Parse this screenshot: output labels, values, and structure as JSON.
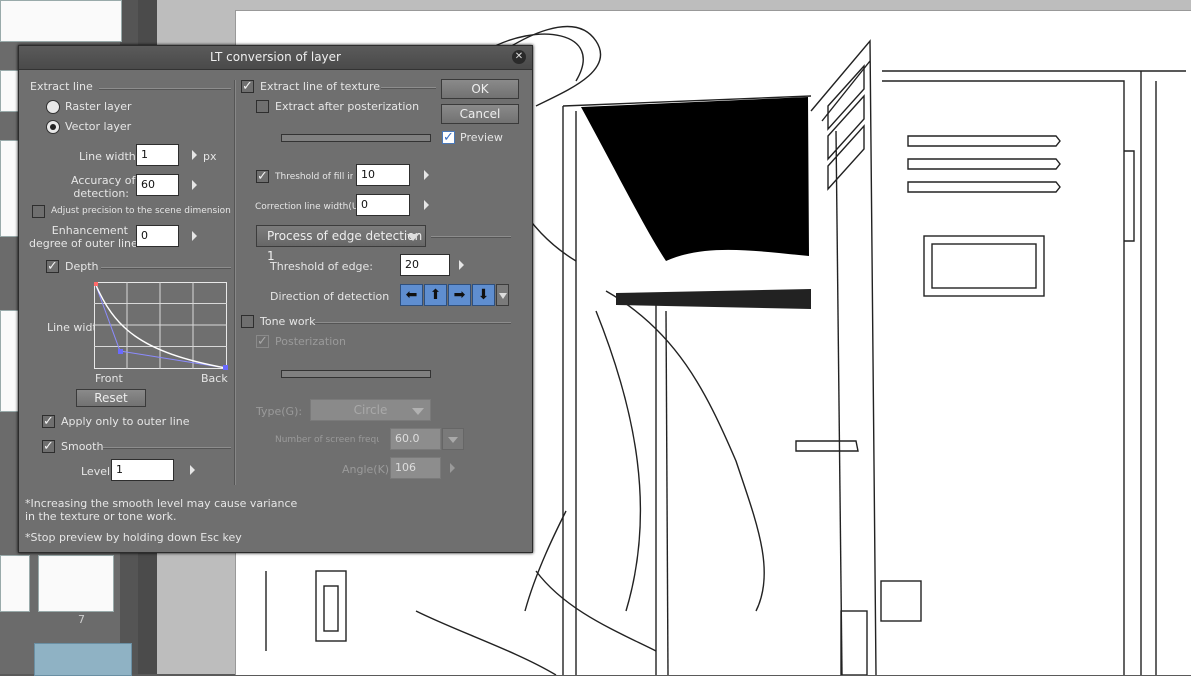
{
  "background": {
    "page_number": "7"
  },
  "dialog": {
    "title": "LT conversion of layer",
    "close_icon": "close-icon",
    "extract_line": {
      "section_label": "Extract line",
      "raster_layer": "Raster layer",
      "vector_layer": "Vector layer",
      "selected_output": "Vector layer",
      "line_width_label": "Line width:",
      "line_width_value": "1",
      "line_width_unit": "px",
      "accuracy_label_1": "Accuracy of",
      "accuracy_label_2": "detection:",
      "accuracy_value": "60",
      "adjust_precision_label": "Adjust precision to the scene dimension",
      "adjust_precision_checked": false,
      "enhancement_label_1": "Enhancement",
      "enhancement_label_2": "degree of outer line:",
      "enhancement_value": "0"
    },
    "depth": {
      "label": "Depth",
      "checked": true,
      "graph_y_label": "Line width",
      "graph_x_front": "Front",
      "graph_x_back": "Back",
      "reset_label": "Reset",
      "apply_outer_label": "Apply only to outer line",
      "apply_outer_checked": true
    },
    "smooth": {
      "label": "Smooth",
      "checked": true,
      "level_label": "Level:",
      "level_value": "1"
    },
    "notes": {
      "line1": "*Increasing the smooth level may cause variance",
      "line2": "in the texture or tone work.",
      "line3": "*Stop preview by holding down Esc key"
    },
    "texture": {
      "extract_texture_label": "Extract line of texture",
      "extract_texture_checked": true,
      "extract_after_poster_label": "Extract after posterization",
      "extract_after_poster_checked": false,
      "threshold_fill_label": "Threshold of fill in bla",
      "threshold_fill_checked": true,
      "threshold_fill_value": "10",
      "correction_label": "Correction line width(U):",
      "correction_value": "0",
      "process_combo": "Process of edge detection 1",
      "threshold_edge_label": "Threshold of edge:",
      "threshold_edge_value": "20",
      "direction_label": "Direction of detection",
      "direction_icons": [
        "arrow-left-icon",
        "arrow-up-icon",
        "arrow-right-icon",
        "arrow-down-icon"
      ]
    },
    "tone": {
      "tone_work_label": "Tone work",
      "tone_work_checked": false,
      "posterization_label": "Posterization",
      "posterization_checked": true,
      "type_label": "Type(G):",
      "type_value": "Circle",
      "screen_freq_label": "Number of screen frequency(",
      "screen_freq_value": "60.0",
      "angle_label": "Angle(K):",
      "angle_value": "106"
    },
    "buttons": {
      "ok": "OK",
      "cancel": "Cancel",
      "preview_label": "Preview",
      "preview_checked": true
    }
  }
}
